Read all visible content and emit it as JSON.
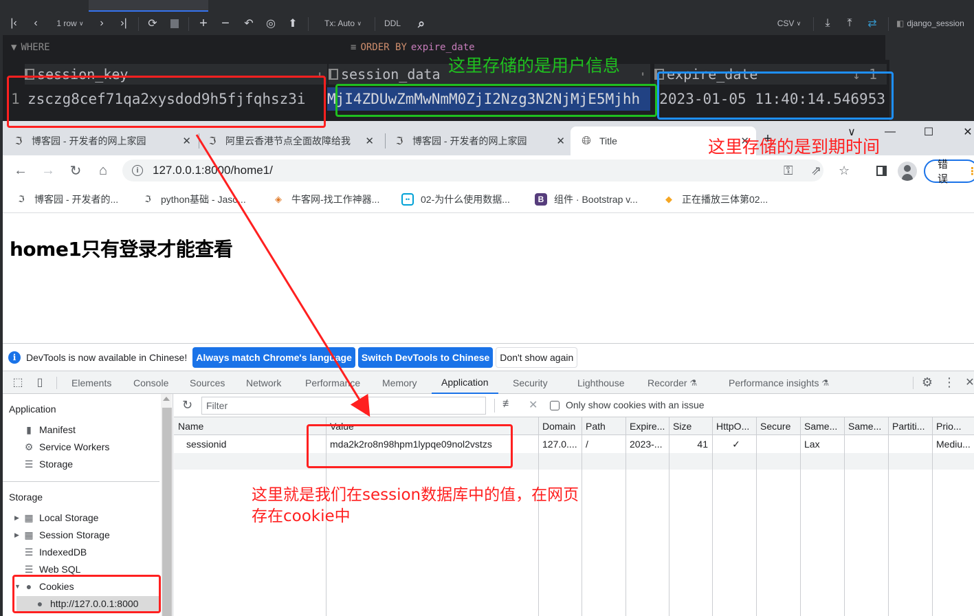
{
  "ide": {
    "toolbar": {
      "rows": "1 row",
      "tx": "Tx: Auto",
      "ddl": "DDL",
      "export_format": "CSV",
      "table_name": "django_session"
    },
    "filter": {
      "where": "WHERE",
      "order_by_kw": "ORDER BY",
      "order_by_col": "expire_date"
    },
    "grid": {
      "columns": [
        {
          "name": "session_key",
          "sort": ""
        },
        {
          "name": "session_data",
          "sort": ""
        },
        {
          "name": "expire_date",
          "sort": "1"
        }
      ],
      "rows": [
        {
          "num": "1",
          "session_key": "zsczg8cef71qa2xysdod9h5fjfqhsz3i",
          "session_data": "MjI4ZDUwZmMwNmM0ZjI2Nzg3N2NjMjE5Mjhh",
          "expire_date": "2023-01-05 11:40:14.546953"
        }
      ]
    }
  },
  "browser": {
    "tabs": [
      {
        "title": "博客园 - 开发者的网上家园",
        "active": false
      },
      {
        "title": "阿里云香港节点全面故障给我",
        "active": false
      },
      {
        "title": "博客园 - 开发者的网上家园",
        "active": false
      },
      {
        "title": "Title",
        "active": true
      }
    ],
    "new_tab": "+",
    "url": "127.0.0.1:8000/home1/",
    "error_button": "错误",
    "bookmarks": [
      {
        "label": "博客园 - 开发者的...",
        "icon": "cnblogs-icon"
      },
      {
        "label": "python基础 - Jaso...",
        "icon": "cnblogs-icon"
      },
      {
        "label": "牛客网-找工作神器...",
        "icon": "nowcoder-icon"
      },
      {
        "label": "02-为什么使用数据...",
        "icon": "bilibili-icon"
      },
      {
        "label": "组件 · Bootstrap v...",
        "icon": "bootstrap-icon"
      },
      {
        "label": "正在播放三体第02...",
        "icon": "video-icon"
      }
    ],
    "page_heading": "home1只有登录才能查看"
  },
  "devtools": {
    "infobar": {
      "message": "DevTools is now available in Chinese!",
      "btn_match": "Always match Chrome's language",
      "btn_switch": "Switch DevTools to Chinese",
      "btn_dismiss": "Don't show again"
    },
    "tabs": [
      "Elements",
      "Console",
      "Sources",
      "Network",
      "Performance",
      "Memory",
      "Application",
      "Security",
      "Lighthouse",
      "Recorder",
      "Performance insights"
    ],
    "active_tab": "Application",
    "sidebar": {
      "application_title": "Application",
      "application_items": [
        "Manifest",
        "Service Workers",
        "Storage"
      ],
      "storage_title": "Storage",
      "storage_items": [
        "Local Storage",
        "Session Storage",
        "IndexedDB",
        "Web SQL",
        "Cookies"
      ],
      "cookie_origin": "http://127.0.0.1:8000"
    },
    "cookies": {
      "filter_placeholder": "Filter",
      "only_issue_label": "Only show cookies with an issue",
      "only_issue_checked": false,
      "columns": [
        "Name",
        "Value",
        "Domain",
        "Path",
        "Expire...",
        "Size",
        "HttpO...",
        "Secure",
        "Same...",
        "Same...",
        "Partiti...",
        "Prio..."
      ],
      "rows": [
        [
          "sessionid",
          "mda2k2ro8n98hpm1lypqe09nol2vstzs",
          "127.0....",
          "/",
          "2023-...",
          "41",
          "✓",
          "",
          "Lax",
          "",
          "",
          "Mediu..."
        ]
      ]
    }
  },
  "annotations": {
    "user_info": "这里存储的是用户信息",
    "expire_time": "这里存储的是到期时间",
    "cookie_note_line1": "这里就是我们在session数据库中的值，在网页",
    "cookie_note_line2": "存在cookie中",
    "colors": {
      "red": "#ff2020",
      "green": "#1fbf1f",
      "blue": "#1e90ff"
    }
  }
}
